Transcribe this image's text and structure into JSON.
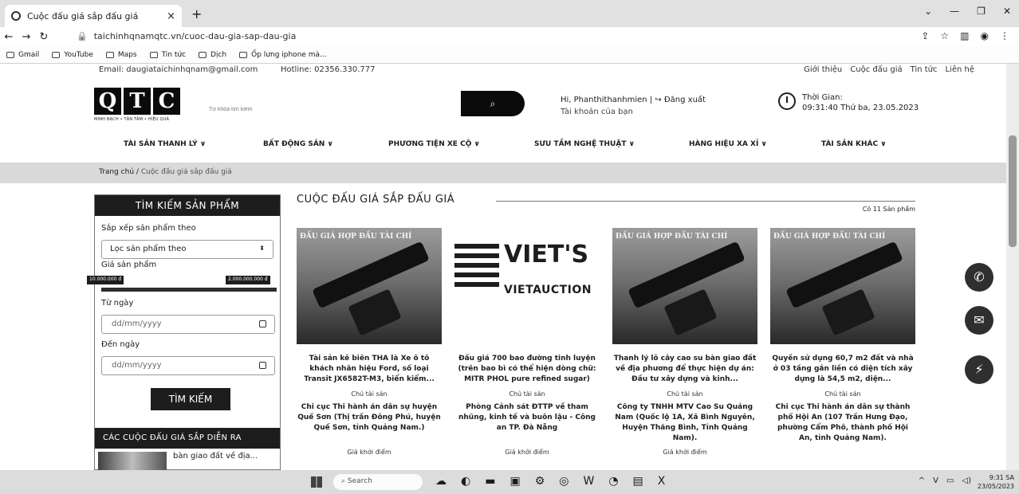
{
  "browser": {
    "tab_title": "Cuộc đấu giá sắp đấu giá",
    "tab_close": "×",
    "new_tab": "+",
    "url": "taichinhqnamqtc.vn/cuoc-dau-gia-sap-dau-gia",
    "bookmarks": [
      "Gmail",
      "YouTube",
      "Maps",
      "Tin tức",
      "Dịch",
      "Ốp lưng iphone mà..."
    ]
  },
  "topbar": {
    "email": "Email: daugiataichinhqnam@gmail.com",
    "hotline": "Hotline: 02356.330.777",
    "links": [
      "Giới thiệu",
      "Cuộc đấu giá",
      "Tin tức",
      "Liên hệ"
    ]
  },
  "header": {
    "logo_letters": [
      "Q",
      "T",
      "C"
    ],
    "logo_slogan": "MINH BẠCH • TẬN TÂM • HIỆU QUẢ",
    "search_placeholder": "Từ khóa tìm kiếm",
    "search_icon": "search-icon",
    "user_greeting": "Hi, Phanthithanhmien",
    "logout": "Đăng xuất",
    "account_label": "Tài khoản của bạn",
    "time_label": "Thời Gian:",
    "time_value": "09:31:40 Thứ ba, 23.05.2023"
  },
  "nav": {
    "items": [
      "TÀI SẢN THANH LÝ ∨",
      "BẤT ĐỘNG SẢN ∨",
      "PHƯƠNG TIỆN XE CỘ ∨",
      "SƯU TẦM NGHỆ THUẬT ∨",
      "HÀNG HIỆU XA XỈ ∨",
      "TÀI SẢN KHÁC ∨"
    ]
  },
  "breadcrumb": {
    "home": "Trang chủ",
    "separator": "/",
    "current": "Cuộc đấu giá sắp đấu giá"
  },
  "sidebar": {
    "title": "TÌM KIẾM SẢN PHẨM",
    "sort_label": "Sắp xếp sản phẩm theo",
    "sort_value": "Lọc sản phẩm theo",
    "price_label": "Giá sản phẩm",
    "price_min": "10.000.000 đ",
    "price_max": "2.000.000.000 đ",
    "from_label": "Từ ngày",
    "from_placeholder": "dd/mm/yyyy",
    "to_label": "Đến ngày",
    "to_placeholder": "dd/mm/yyyy",
    "submit": "TÌM KIẾM",
    "upcoming_title": "CÁC CUỘC ĐẤU GIÁ SẮP DIỄN RA",
    "upcoming_item": "bàn giao đất về địa..."
  },
  "main": {
    "title": "CUỘC ĐẤU GIÁ SẮP ĐẤU GIÁ",
    "count": "Có 11 Sản phẩm",
    "owner_label": "Chủ tài sản",
    "price_label": "Giá khởi điểm",
    "cards": [
      {
        "image_caption": "ĐẤU GIÁ HỢP ĐẤU TÀI CHÍ",
        "title": "Tài sản kê biên THA là Xe ô tô khách nhãn hiệu Ford, số loại Transit JX6582T-M3, biển kiểm...",
        "owner": "Chi cục Thi hành án dân sự huyện Quế Sơn (Thị trấn Đông Phú, huyện Quế Sơn, tỉnh Quảng Nam.)"
      },
      {
        "image_text_big": "VIET'S",
        "image_text_small": "VIETAUCTION",
        "title": "Đấu giá 700 bao đường tinh luyện (trên bao bì có thể hiện dòng chữ: MITR PHOL pure refined sugar)",
        "owner": "Phòng Cảnh sát ĐTTP về tham nhũng, kinh tế và buôn lậu - Công an TP. Đà Nẵng"
      },
      {
        "image_caption": "ĐẤU GIÁ HỢP ĐẤU TÀI CHÍ",
        "title": "Thanh lý lô cây cao su bàn giao đất về địa phương để thực hiện dự án: Đầu tư xây dựng và kinh...",
        "owner": "Công ty TNHH MTV Cao Su Quảng Nam (Quốc lộ 1A, Xã Bình Nguyên, Huyện Thăng Bình, Tỉnh Quảng Nam)."
      },
      {
        "image_caption": "ĐẤU GIÁ HỢP ĐẤU TÀI CHÍ",
        "title": "Quyền sử dụng 60,7 m2 đất và nhà ở 03 tầng gắn liền có diện tích xây dựng là 54,5 m2, diện...",
        "owner": "Chi cục Thi hành án dân sự thành phố Hội An (107 Trần Hưng Đạo, phường Cẩm Phô, thành phố Hội An, tỉnh Quảng Nam)."
      }
    ]
  },
  "taskbar": {
    "search": "Search",
    "time": "9:31 SA",
    "date": "23/05/2023"
  }
}
